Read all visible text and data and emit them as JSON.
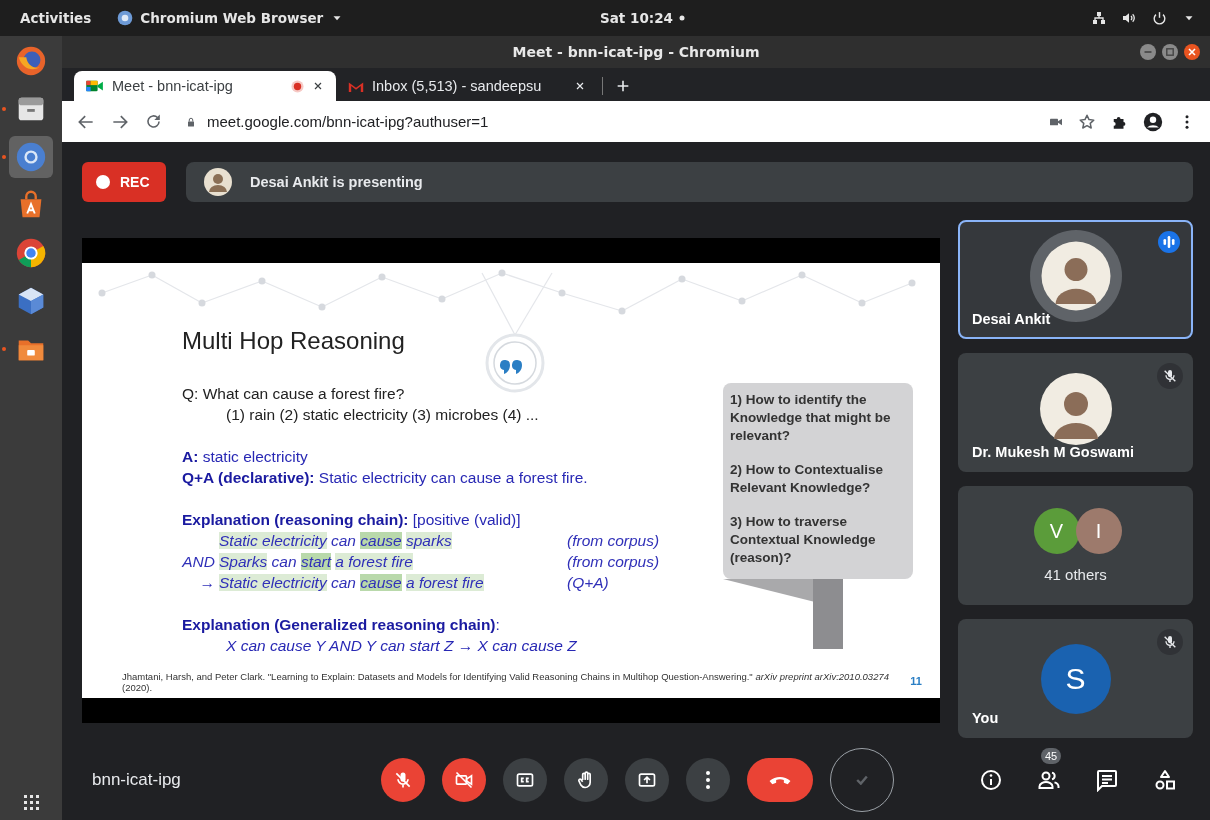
{
  "top_bar": {
    "activities": "Activities",
    "app_menu": "Chromium Web Browser",
    "clock": "Sat 10:24"
  },
  "dock": {
    "items": [
      {
        "kind": "globe",
        "selected": false,
        "running": false
      },
      {
        "kind": "drawer",
        "selected": false,
        "running": true
      },
      {
        "kind": "chromium",
        "selected": true,
        "running": true
      },
      {
        "kind": "bag",
        "selected": false,
        "running": false
      },
      {
        "kind": "chrome",
        "selected": false,
        "running": false
      },
      {
        "kind": "cube",
        "selected": false,
        "running": false
      },
      {
        "kind": "folder",
        "selected": false,
        "running": true
      }
    ]
  },
  "window": {
    "title": "Meet - bnn-icat-ipg - Chromium"
  },
  "tabs": [
    {
      "kind": "meet",
      "label": "Meet - bnn-icat-ipg",
      "selected": true,
      "recording": true
    },
    {
      "kind": "mail",
      "label": "Inbox (5,513) - sandeepsu",
      "selected": false,
      "recording": false
    }
  ],
  "address_bar": {
    "url": "meet.google.com/bnn-icat-ipg?authuser=1"
  },
  "meeting": {
    "recording_label": "REC",
    "presenting_text": "Desai Ankit is presenting",
    "meeting_code": "bnn-icat-ipg"
  },
  "slide": {
    "title": "Multi Hop Reasoning",
    "question": "Q: What can cause a forest fire?",
    "options": "(1) rain (2) static electricity (3) microbes (4) ...",
    "answer": "**A:** static electricity",
    "declarative": "**Q+A (declarative):** Static electricity can cause a forest fire.",
    "chain_heading": "**Explanation (reasoning chain):** [positive (valid)]",
    "chain": [
      {
        "segments": [
          {
            "text": "Static electricity",
            "highlighted": true,
            "strong": false
          },
          {
            "text": "can",
            "highlighted": false,
            "strong": false
          },
          {
            "text": "cause",
            "highlighted": true,
            "strong": true
          },
          {
            "text": "sparks",
            "highlighted": true,
            "strong": false
          }
        ],
        "source": "(from corpus)"
      },
      {
        "prefix": "AND",
        "segments": [
          {
            "text": "Sparks",
            "highlighted": true,
            "strong": false
          },
          {
            "text": "can",
            "highlighted": false,
            "strong": false
          },
          {
            "text": "start",
            "highlighted": true,
            "strong": true
          },
          {
            "text": "a forest fire",
            "highlighted": true,
            "strong": false
          }
        ],
        "source": "(from corpus)"
      },
      {
        "prefix": "→",
        "segments": [
          {
            "text": "Static electricity",
            "highlighted": true,
            "strong": false
          },
          {
            "text": "can",
            "highlighted": false,
            "strong": false
          },
          {
            "text": "cause",
            "highlighted": true,
            "strong": true
          },
          {
            "text": "a forest fire",
            "highlighted": true,
            "strong": false
          }
        ],
        "source": "(Q+A)"
      }
    ],
    "general_heading": "**Explanation (Generalized reasoning chain)**:",
    "general_chain": "X can cause Y AND Y can start Z → X can cause Z",
    "callout": [
      "1) How to identify the Knowledge that might be relevant?",
      "2) How to Contextualise Relevant Knowledge?",
      "3) How to traverse Contextual Knowledge (reason)?"
    ],
    "citation": "Jhamtani, Harsh, and Peter Clark. \"Learning to Explain: Datasets and Models for Identifying Valid Reasoning Chains in Multihop Question-Answering.\" *arXiv preprint arXiv:2010.03274* (2020).",
    "page_number": "11"
  },
  "participants": [
    {
      "kind": "photo",
      "name": "Desai Ankit",
      "speaking": true,
      "muted": false
    },
    {
      "kind": "photo",
      "name": "Dr. Mukesh M Goswami",
      "speaking": false,
      "muted": true
    },
    {
      "kind": "group",
      "label": "41 others",
      "avatars": [
        {
          "initial": "V",
          "color": "#5b9c3a"
        },
        {
          "initial": "I",
          "color": "#9d7a6c"
        }
      ]
    },
    {
      "kind": "initial",
      "name": "You",
      "initial": "S",
      "color": "#1a62b0",
      "speaking": false,
      "muted": true
    }
  ],
  "controls": [
    {
      "kind": "mic",
      "off": true
    },
    {
      "kind": "camera",
      "off": true
    },
    {
      "kind": "captions"
    },
    {
      "kind": "hand"
    },
    {
      "kind": "present"
    },
    {
      "kind": "more"
    },
    {
      "kind": "hangup"
    },
    {
      "kind": "check"
    }
  ],
  "side_controls": [
    {
      "kind": "info"
    },
    {
      "kind": "people",
      "badge": "45"
    },
    {
      "kind": "chat"
    },
    {
      "kind": "activities"
    }
  ]
}
